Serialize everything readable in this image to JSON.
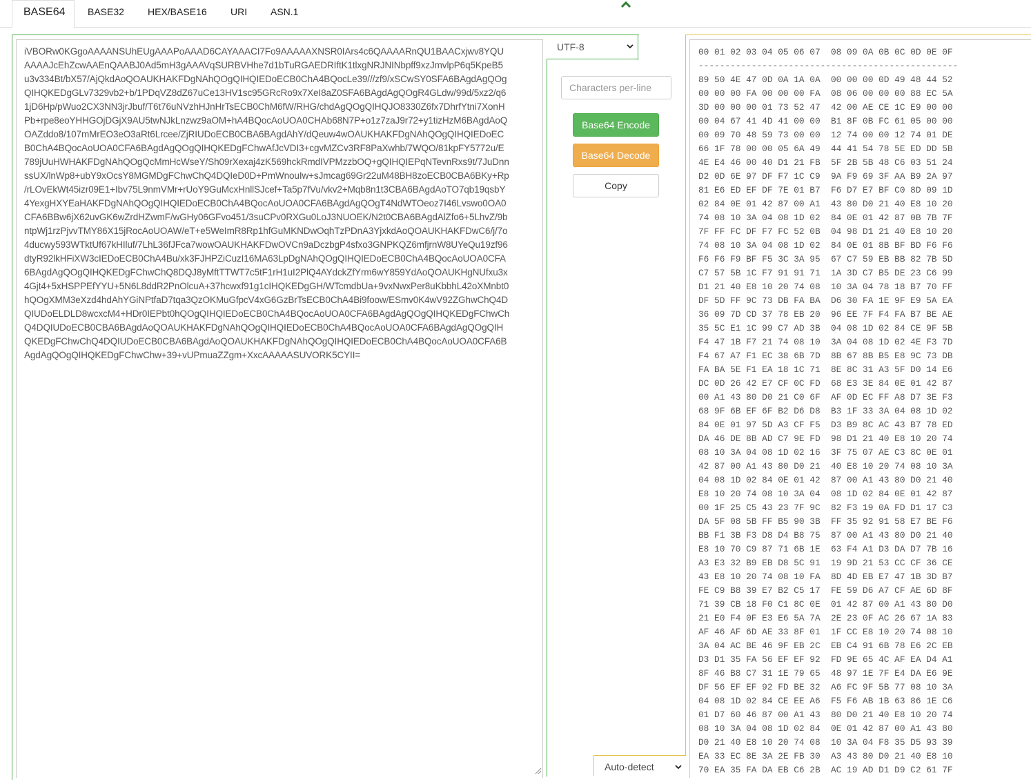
{
  "tabs": [
    {
      "label": "BASE64",
      "active": true
    },
    {
      "label": "BASE32",
      "active": false
    },
    {
      "label": "HEX/BASE16",
      "active": false
    },
    {
      "label": "URI",
      "active": false
    },
    {
      "label": "ASN.1",
      "active": false
    }
  ],
  "controls": {
    "encoding": "UTF-8",
    "chars_per_line_placeholder": "Characters per-line",
    "encode_label": "Base64 Encode",
    "decode_label": "Base64 Decode",
    "copy_label": "Copy",
    "autodetect": "Auto-detect"
  },
  "colors": {
    "encode_button": "#5cb85c",
    "decode_button": "#f0ad4e",
    "left_frame": "#4cae4c",
    "right_frame": "#e6c34a"
  },
  "icons": {
    "collapse": "chevron-up-icon",
    "select": "chevron-down-icon",
    "resize": "resize-grip-icon"
  },
  "base64_lines": [
    "iVBORw0KGgoAAAANSUhEUgAAAPoAAAD6CAYAAACI7Fo9AAAAAXNSR0IArs4c6QAAAARnQU1BAACxjwv8YQU",
    "AAAAJcEhZcwAAEnQAABJ0Ad5mH3gAAAVqSURBVHhe7d1bTuRGAEDRIftK1tlxgNRJNINbpff9xzJmvlpP6q5KpeB5",
    "u3v334Bt/bX57/AjQkdAoQOAUKHAKFDgNAhQOgQIHQIEDoECB0ChA4BQocLe39///zf9/xSCwSY0SFA6BAgdAgQOg",
    "QIHQKEDgGLv7329vb2+b/1PDqVZ8dZ67uCe13HV1sc95GRcRo9x7XeI8aZ0SFA6BAgdAgQOgR4GLdw/99d/5xz2/q6",
    "1jD6Hp/pWuo2CX3NN3jrJbuf/T6t76uNVzhHJnHrTsECB0ChM6fW/RHG/chdAgQOgQIHQJO8330Z6fx7DhrfYtni7XonH",
    "Pb+rpe8eoYHHGOjDGjX9AU5twNJkLnzwz9aOM+hA4BQocAoUOA0CHAb68N7P+o1z7zaJ9r72+y1tizHzM6BAgdAoQ",
    "OAZddo8/107mMrEO3eO3aRt6Lrcee/ZjRIUDoECB0CBA6BAgdAhY/dQeuw4wOAUKHAKFDgNAhQOgQIHQIEDoEC",
    "B0ChA4BQocAoUOA0CFA6BAgdAgQOgQIHQKEDgFChwAfJcVDI3+cgvMZCv3RF8PaXwhb/7WQO/81kpFY5772u/E",
    "789jUuHWHAKFDgNAhQOgQcMmHcWseY/Sh09rXexaj4zK569hckRmdIVPMzzbOQ+gQIHQIEPqNTevnRxs9t/7JuDnn",
    "ssUX/lnWp8+ubY9xOcsY8MGMDgFChwChQ4DQIeD0D+PmWnouIw+sJmcag69Gr22uM48BH8zoECB0CBA6BKy+Rp",
    "/rLOvEkWt45izr09E1+Ibv75L9nmVMr+rUoY9GuMcxHnllSJcef+Ta5p7fVu/vkv2+Mqb8n1t3CBA6BAgdAoTO7qb19qsbY",
    "4YexgHXYEaHAKFDgNAhQOgQIHQIEDoECB0ChA4BQocAoUOA0CFA6BAgdAgQOgT4NdWTOeoz7I46Lvswo0OA0",
    "CFA6BBw6jX62uvGK6wZrdHZwmF/wGHy06GFvo451/3suCPv0RXGu0LoJ3NUOEK/N2t0CBA6BAgdAlZfo6+5LhvZ/9b",
    "ntpWj1rzPjvvTMY86X15jRocAoUOAW/eT+e5WeImR8Rp1hfGuMKNDwOqhTzPDnA3YjxkdAoQOAUKHAKFDwC6/j/7o",
    "4ducwy593WTktUf67kHIluf/7LhL36fJFca7wowOAUKHAKFDwOVCn9aDczbgP4sfxo3GNPKQZ6mfjrnW8UYeQu19zf96",
    "dtyR92lkHFiXW3cIEDoECB0ChA4Bu/xk3FJHPZiCuzI16MA63LpDgNAhQOgQIHQIEDoECB0ChA4BQocAoUOA0CFA",
    "6BAgdAgQOgQIHQKEDgFChwChQ8DQJ8yMftTTWT7c5tF1rH1uI2PlQ4AYdckZfYrm6wY859YdAoQOAUKHgNUfxu3x",
    "4Gjt4+5xHSPPEfYYU+5N6L8ddR2PnOlcuA+37hcwxf91g1cIHQKEDgGH/WTcmdbUa+9vxNwxPer8uKbbhL42oXMnbt0",
    "hQOgXMM3eXzd4hdAhYGiNPtfaD7tqa3QzOKMuGfpcV4xG6GzBrTsECB0ChA4Bi9foow/ESmv0K4wV92ZGhwChQ4D",
    "QIUDoELDLD8wcxcM4+HDr0IEPbt0hQOgQIHQIEDoECB0ChA4BQocAoUOA0CFA6BAgdAgQOgQIHQKEDgFChwCh",
    "Q4DQIUDoECB0CBA6BAgdAoQOAUKHAKFDgNAhQOgQIHQIEDoECB0ChA4BQocAoUOA0CFA6BAgdAgQOgQIH",
    "QKEDgFChwChQ4DQIUDoECB0CBA6BAgdAoQOAUKHAKFDgNAhQOgQIHQIEDoECB0ChA4BQocAoUOA0CFA6B",
    "AgdAgQOgQIHQKEDgFChwChw+39+vUPmuaZZgm+XxcAAAAASUVORK5CYII="
  ],
  "hex_lines": [
    "00 01 02 03 04 05 06 07  08 09 0A 0B 0C 0D 0E 0F",
    "-------------------------------------------------",
    "89 50 4E 47 0D 0A 1A 0A  00 00 00 0D 49 48 44 52",
    "00 00 00 FA 00 00 00 FA  08 06 00 00 00 88 EC 5A",
    "3D 00 00 00 01 73 52 47  42 00 AE CE 1C E9 00 00",
    "00 04 67 41 4D 41 00 00  B1 8F 0B FC 61 05 00 00",
    "00 09 70 48 59 73 00 00  12 74 00 00 12 74 01 DE",
    "66 1F 78 00 00 05 6A 49  44 41 54 78 5E ED DD 5B",
    "4E E4 46 00 40 D1 21 FB  5F 2B 5B 48 C6 03 51 24",
    "D2 0D 6E 97 DF F7 1C C9  9A F9 69 3F AA B9 2A 97",
    "81 E6 ED EF DF 7E 01 B7  F6 D7 E7 BF C0 8D 09 1D",
    "02 84 0E 01 42 87 00 A1  43 80 D0 21 40 E8 10 20",
    "74 08 10 3A 04 08 1D 02  84 0E 01 42 87 0B 7B 7F",
    "7F FF FC DF F7 FC 52 0B  04 98 D1 21 40 E8 10 20",
    "74 08 10 3A 04 08 1D 02  84 0E 01 8B BF BD F6 F6",
    "F6 F6 F9 BF F5 3C 3A 95  67 C7 59 EB BB 82 7B 5D",
    "C7 57 5B 1C F7 91 91 71  1A 3D C7 B5 DE 23 C6 99",
    "D1 21 40 E8 10 20 74 08  10 3A 04 78 18 B7 70 FF",
    "DF 5D FF 9C 73 DB FA BA  D6 30 FA 1E 9F E9 5A EA",
    "36 09 7D CD 37 78 EB 20  96 EE 7F F4 FA B7 BE AE",
    "35 5C E1 1C 99 C7 AD 3B  04 08 1D 02 84 CE 9F 5B",
    "F4 47 1B F7 21 74 08 10  3A 04 08 1D 02 4E F3 7D",
    "F4 67 A7 F1 EC 38 6B 7D  8B 67 8B B5 E8 9C 73 DB",
    "FA BA 5E F1 EA 18 1C 71  8E 8C 31 A3 5F D0 14 E6",
    "DC 0D 26 42 E7 CF 0C FD  68 E3 3E 84 0E 01 42 87",
    "00 A1 43 80 D0 21 C0 6F  AF 0D EC FF A8 D7 3E F3",
    "68 9F 6B EF 6F B2 D6 D8  B3 1F 33 3A 04 08 1D 02",
    "84 0E 01 97 5D A3 CF F5  D3 B9 8C AC 43 B7 78 ED",
    "DA 46 DE 8B AD C7 9E FD  98 D1 21 40 E8 10 20 74",
    "08 10 3A 04 08 1D 02 16  3F 75 07 AE C3 8C 0E 01",
    "42 87 00 A1 43 80 D0 21  40 E8 10 20 74 08 10 3A",
    "04 08 1D 02 84 0E 01 42  87 00 A1 43 80 D0 21 40",
    "E8 10 20 74 08 10 3A 04  08 1D 02 84 0E 01 42 87",
    "00 1F 25 C5 43 23 7F 9C  82 F3 19 0A FD D1 17 C3",
    "DA 5F 08 5B FF B5 90 3B  FF 35 92 91 58 E7 BE F6",
    "BB F1 3B F3 D8 D4 B8 75  87 00 A1 43 80 D0 21 40",
    "E8 10 70 C9 87 71 6B 1E  63 F4 A1 D3 DA D7 7B 16",
    "A3 E3 32 B9 EB D8 5C 91  19 9D 21 53 CC CF 36 CE",
    "43 E8 10 20 74 08 10 FA  8D 4D EB E7 47 1B 3D B7",
    "FE C9 B8 39 E7 B2 C5 17  FE 59 D6 A7 CF AE 6D 8F",
    "71 39 CB 18 F0 C1 8C 0E  01 42 87 00 A1 43 80 D0",
    "21 E0 F4 0F E3 E6 5A 7A  2E 23 0F AC 26 67 1A 83",
    "AF 46 AF 6D AE 33 8F 01  1F CC E8 10 20 74 08 10",
    "3A 04 AC BE 46 9F EB 2C  EB C4 91 6B 78 E6 2C EB",
    "D3 D1 35 FA 56 EF EF 92  FD 9E 65 4C AF EA D4 A1",
    "8F 46 B8 C7 31 1E 79 65  48 97 1E 7F E4 DA E6 9E",
    "DF 56 EF EF 92 FD BE 32  A6 FC 9F 5B 77 08 10 3A",
    "04 08 1D 02 84 CE EE A6  F5 F6 AB 1B 63 86 1E C6",
    "01 D7 60 46 87 00 A1 43  80 D0 21 40 E8 10 20 74",
    "08 10 3A 04 08 1D 02 84  0E 01 42 87 00 A1 43 80",
    "D0 21 40 E8 10 20 74 08  10 3A 04 F8 35 D5 93 39",
    "EA 33 EC 8E 3A 2E FB 30  A3 43 80 D0 21 40 E8 10",
    "70 EA 35 FA DA EB C6 2B  AC 19 AD D1 D9 C2 61 7F"
  ]
}
